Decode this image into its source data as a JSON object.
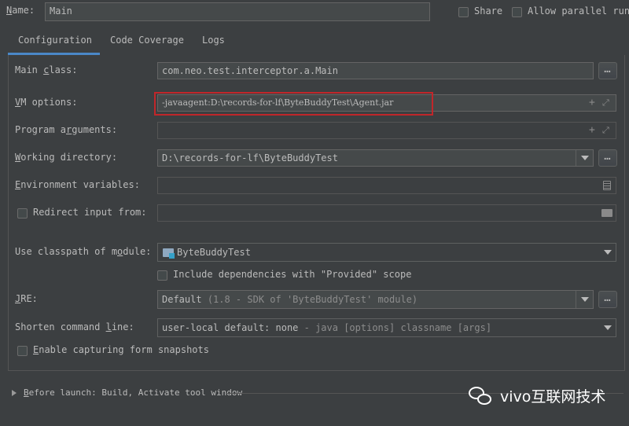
{
  "header": {
    "name_label_pre": "",
    "name_label_u": "N",
    "name_label_post": "ame:",
    "name_value": "Main",
    "share_label": "Share",
    "allow_parallel_label": "Allow parallel run"
  },
  "tabs": [
    {
      "label": "Configuration",
      "active": true
    },
    {
      "label": "Code Coverage",
      "active": false
    },
    {
      "label": "Logs",
      "active": false
    }
  ],
  "form": {
    "main_class": {
      "label_pre": "Main ",
      "label_u": "c",
      "label_post": "lass:",
      "value": "com.neo.test.interceptor.a.Main"
    },
    "vm_options": {
      "label_pre": "",
      "label_u": "V",
      "label_post": "M options:",
      "value": "-javaagent:D:\\records-for-lf\\ByteBuddyTest\\Agent.jar"
    },
    "program_args": {
      "label_pre": "Program a",
      "label_u": "r",
      "label_post": "guments:",
      "value": ""
    },
    "working_dir": {
      "label_pre": "",
      "label_u": "W",
      "label_post": "orking directory:",
      "value": "D:\\records-for-lf\\ByteBuddyTest"
    },
    "env_vars": {
      "label_pre": "",
      "label_u": "E",
      "label_post": "nvironment variables:",
      "value": ""
    },
    "redirect_input": {
      "label": "Redirect input from:",
      "value": ""
    },
    "classpath_module": {
      "label_pre": "Use classpath of m",
      "label_u": "o",
      "label_post": "dule:",
      "value": "ByteBuddyTest"
    },
    "include_deps_label": "Include dependencies with \"Provided\" scope",
    "jre": {
      "label_pre": "",
      "label_u": "J",
      "label_post": "RE:",
      "value_main": "Default",
      "value_detail": "(1.8 - SDK of 'ByteBuddyTest' module)"
    },
    "shorten_cmd": {
      "label_pre": "Shorten command ",
      "label_u": "l",
      "label_post": "ine:",
      "value_main": "user-local default: none",
      "value_detail": "- java [options] classname [args]"
    },
    "enable_snapshots": {
      "label_pre": "",
      "label_u": "E",
      "label_post": "nable capturing form snapshots"
    }
  },
  "before_launch": {
    "label_pre": "",
    "label_u": "B",
    "label_post": "efore launch: Build, Activate tool window"
  },
  "watermark": {
    "text": "vivo互联网技术"
  },
  "colors": {
    "background": "#3c3f41",
    "field_bg": "#45494a",
    "tab_accent": "#4a88c7",
    "highlight_box": "#c1262a"
  }
}
